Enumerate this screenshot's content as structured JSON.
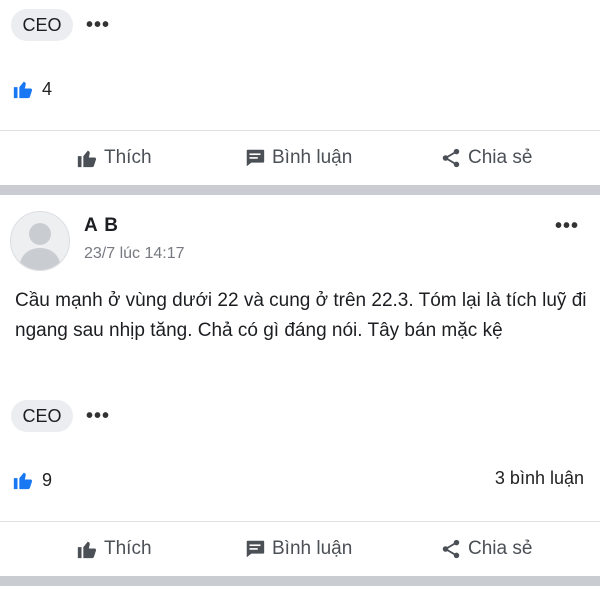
{
  "post1": {
    "badge": "CEO",
    "more": "•••",
    "likes": "4",
    "actions": {
      "like": "Thích",
      "comment": "Bình luận",
      "share": "Chia sẻ"
    }
  },
  "post2": {
    "author": "A B",
    "time": "23/7 lúc 14:17",
    "more": "•••",
    "text": "Cầu mạnh ở vùng dưới 22 và cung ở trên 22.3. Tóm lại là tích luỹ đi ngang sau nhịp tăng. Chả có gì đáng nói. Tây bán mặc kệ",
    "badge": "CEO",
    "badge_more": "•••",
    "likes": "9",
    "comments": "3 bình luận",
    "actions": {
      "like": "Thích",
      "comment": "Bình luận",
      "share": "Chia sẻ"
    }
  },
  "colors": {
    "like_blue": "#1877f2",
    "action_gray": "#4b4f56",
    "separator": "#c9ccd1"
  }
}
